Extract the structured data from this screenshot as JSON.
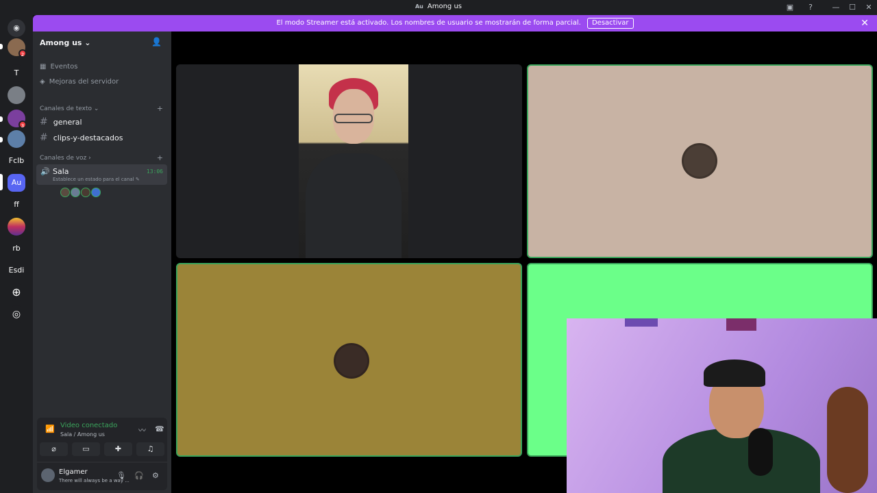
{
  "window": {
    "title": "Among us",
    "title_icon": "Au"
  },
  "streamer_banner": {
    "message": "El modo Streamer está activado. Los nombres de usuario se mostrarán de forma parcial.",
    "button": "Desactivar",
    "close": "✕"
  },
  "servers": [
    {
      "label": "",
      "badge": "2"
    },
    {
      "label": "T"
    },
    {
      "label": ""
    },
    {
      "label": "",
      "badge": "3"
    },
    {
      "label": ""
    },
    {
      "label": "Fclb"
    },
    {
      "label": "Au"
    },
    {
      "label": "ff"
    },
    {
      "label": ""
    },
    {
      "label": "rb"
    },
    {
      "label": "Esdi"
    }
  ],
  "guild": {
    "name": "Among us ⌄"
  },
  "nav": {
    "events": "Eventos",
    "boosts": "Mejoras del servidor"
  },
  "text_category": {
    "label": "Canales de texto ⌄",
    "plus": "+"
  },
  "text_channels": [
    {
      "name": "general"
    },
    {
      "name": "clips-y-destacados"
    }
  ],
  "voice_category": {
    "label": "Canales de voz ›",
    "plus": "+"
  },
  "voice_channel": {
    "name": "Sala",
    "status": "Establece un estado para el canal ✎",
    "timer": "13:06"
  },
  "rtc": {
    "status": "Video conectado",
    "location": "Sala / Among us"
  },
  "user": {
    "name": "Elgamer",
    "status": "There will always be a way ..."
  },
  "colors": {
    "accent": "#9b4bf0",
    "green": "#3ba55c",
    "tile_beige": "#c8b3a4",
    "tile_olive": "#9b8438",
    "tile_green": "#6bff89"
  }
}
